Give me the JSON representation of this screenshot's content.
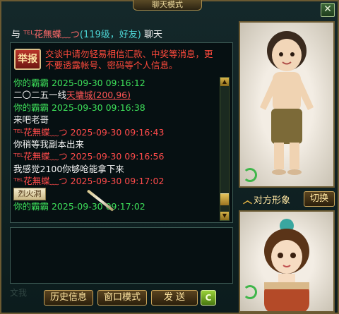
{
  "window": {
    "title": "聊天模式",
    "close_label": "✕"
  },
  "header": {
    "prefix": "与",
    "friend_name": "ᵀᴱᴸ花無蝶﹏つ",
    "level": "(119级，好友)",
    "suffix": "聊天"
  },
  "report": {
    "label": "举报",
    "warning": "交谈中请勿轻易相信汇款、中奖等消息，更不要透露帐号、密码等个人信息。"
  },
  "messages": [
    {
      "type": "self-header",
      "text": "你的霸霸  2025-09-30 09:16:12"
    },
    {
      "type": "text-link",
      "text": "二〇二五一线",
      "link": "天墉城(200,96)"
    },
    {
      "type": "self-header",
      "text": "你的霸霸  2025-09-30 09:16:38"
    },
    {
      "type": "text",
      "text": "来吧老哥"
    },
    {
      "type": "friend-header",
      "text": "ᵀᴱᴸ花無蝶﹏つ  2025-09-30 09:16:43"
    },
    {
      "type": "text",
      "text": "你稍等我副本出来"
    },
    {
      "type": "friend-header",
      "text": "ᵀᴱᴸ花無蝶﹏つ  2025-09-30 09:16:56"
    },
    {
      "type": "text",
      "text": "我感觉2100你够呛能拿下来"
    },
    {
      "type": "friend-header",
      "text": "ᵀᴱᴸ花無蝶﹏つ  2025-09-30 09:17:02"
    },
    {
      "type": "item",
      "item": "烈火洞",
      "text": ""
    },
    {
      "type": "self-header",
      "text": "你的霸霸  2025-09-30 09:17:02"
    }
  ],
  "buttons": {
    "history": "历史信息",
    "window_mode": "窗口模式",
    "send": "发 送",
    "send_shortcut": "C",
    "view_direction": "对方形象",
    "switch": "切换"
  },
  "faded_input_text": "文我"
}
